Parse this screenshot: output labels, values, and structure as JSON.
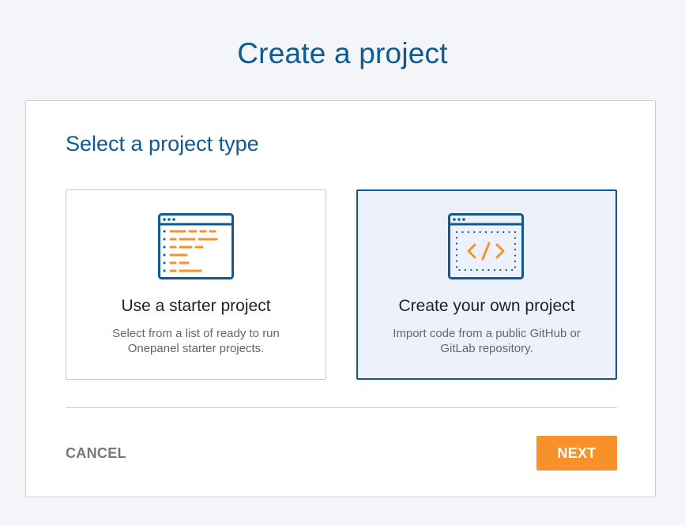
{
  "page": {
    "title": "Create a project"
  },
  "panel": {
    "section_title": "Select a project type",
    "cards": [
      {
        "id": "starter",
        "title": "Use a starter project",
        "description": "Select from a list of ready to run Onepanel starter projects.",
        "icon": "code-editor-lines-icon",
        "selected": false
      },
      {
        "id": "own",
        "title": "Create your own project",
        "description": "Import code from a public GitHub or GitLab repository.",
        "icon": "code-brackets-icon",
        "selected": true
      }
    ],
    "cancel_label": "CANCEL",
    "next_label": "NEXT"
  },
  "colors": {
    "brand_blue": "#0e5a94",
    "accent_orange": "#f7922a",
    "selected_bg": "#edf1fb",
    "page_bg": "#f4f5f8"
  }
}
